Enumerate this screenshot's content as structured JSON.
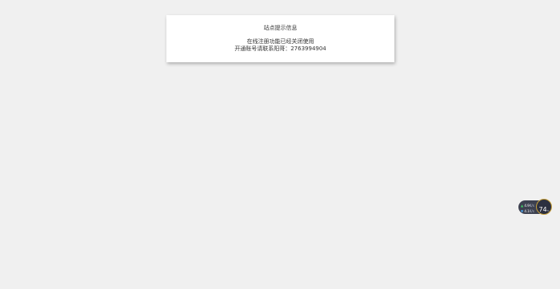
{
  "notice": {
    "title": "站点提示信息",
    "message_line1": "在线注册功能已经关闭使用",
    "message_line2": "开通账号请联系阳哥：2763994904"
  },
  "net_monitor": {
    "upload_value": "4.9",
    "upload_unit": "K/s",
    "download_value": "4.1",
    "download_unit": "K/s",
    "usage_value": "74",
    "usage_unit": "%",
    "colors": {
      "pill": "#3d4150",
      "ring": "#c7a03b",
      "up_arrow": "#41d66a",
      "down_arrow": "#4fb0ff"
    }
  }
}
